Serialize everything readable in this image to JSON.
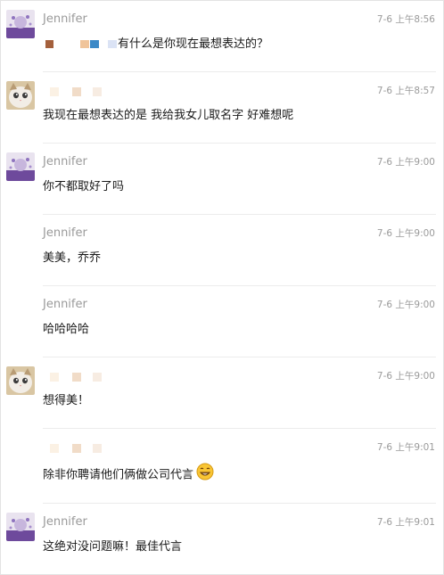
{
  "messages": [
    {
      "sender": "",
      "avatar": "jennifer-avatar",
      "time": "7-6 上午8:56",
      "text": "有什么是你现在最想表达的？"
    },
    {
      "sender": "",
      "avatar": "cat-avatar",
      "time": "7-6 上午8:57",
      "text": "我现在最想表达的是 我给我女儿取名字 好难想呢"
    },
    {
      "sender": "Jennifer",
      "avatar": "jennifer-avatar",
      "time": "7-6 上午9:00",
      "text": "你不都取好了吗"
    },
    {
      "sender": "Jennifer",
      "avatar": "",
      "time": "7-6 上午9:00",
      "text": "美美，乔乔"
    },
    {
      "sender": "Jennifer",
      "avatar": "",
      "time": "7-6 上午9:00",
      "text": "哈哈哈哈"
    },
    {
      "sender": "",
      "avatar": "cat-avatar",
      "time": "7-6 上午9:00",
      "text": "想得美！"
    },
    {
      "sender": "",
      "avatar": "",
      "time": "7-6 上午9:01",
      "text": "除非你聘请他们俩做公司代言",
      "emoji": "grin-emoji"
    },
    {
      "sender": "Jennifer",
      "avatar": "jennifer-avatar",
      "time": "7-6 上午9:01",
      "text": "这绝对没问题嘛！最佳代言"
    }
  ],
  "first_sender_display": "Jennifer",
  "colors": {
    "name": "#9a9a9a",
    "time": "#9a9a9a",
    "text": "#1a1a1a",
    "divider": "#ececec"
  }
}
